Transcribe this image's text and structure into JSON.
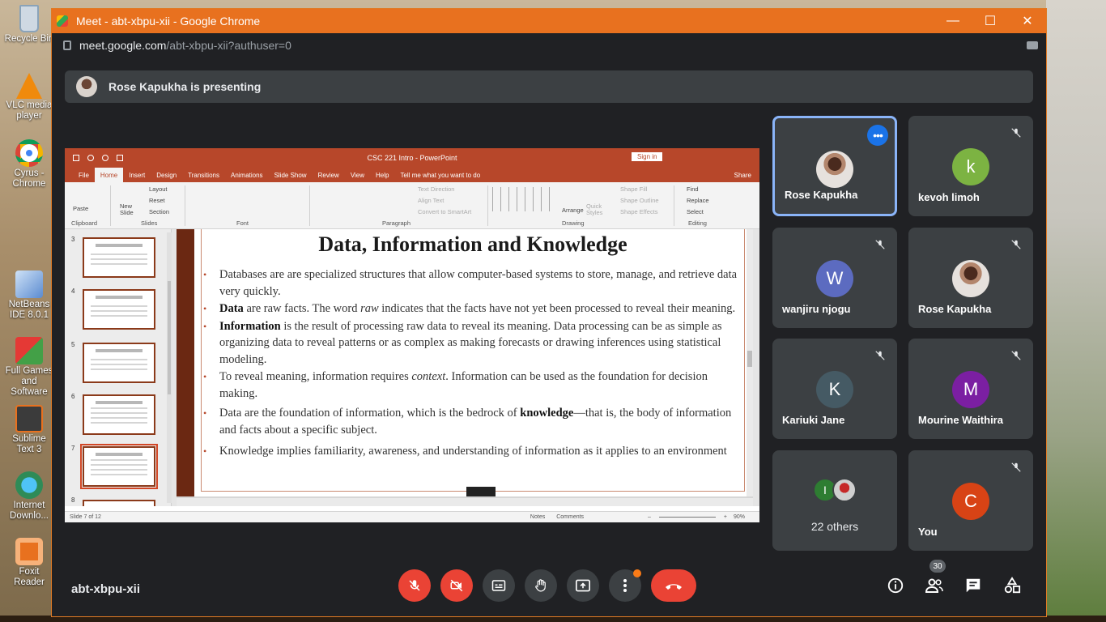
{
  "desktop": {
    "icons": [
      {
        "label": "Recycle Bin",
        "color": "#9fb8cf"
      },
      {
        "label": "VLC media player",
        "color": "#f08a0c"
      },
      {
        "label": "Cyrus - Chrome",
        "color": "#db4437"
      },
      {
        "label": "NetBeans IDE 8.0.1",
        "color": "#5b8bd0"
      },
      {
        "label": "Full Games and Software",
        "color": "#c62828"
      },
      {
        "label": "Sublime Text 3",
        "color": "#e8711f"
      },
      {
        "label": "Internet Downlo...",
        "color": "#2e8b57"
      },
      {
        "label": "Foxit Reader",
        "color": "#e8711f"
      }
    ]
  },
  "window": {
    "title": "Meet - abt-xbpu-xii - Google Chrome",
    "url_host": "meet.google.com",
    "url_path": "/abt-xbpu-xii?authuser=0",
    "accent": "#e8711f"
  },
  "meet": {
    "presenting_banner": "Rose Kapukha is presenting",
    "meeting_code": "abt-xbpu-xii",
    "participant_count": "30",
    "others_label": "22 others",
    "tiles": [
      {
        "name": "Rose Kapukha",
        "initial": "",
        "avatar_color": "",
        "muted": false,
        "active": true
      },
      {
        "name": "kevoh limoh",
        "initial": "k",
        "avatar_color": "#7cb342",
        "muted": true,
        "active": false
      },
      {
        "name": "wanjiru njogu",
        "initial": "W",
        "avatar_color": "#5c6bc0",
        "muted": true,
        "active": false
      },
      {
        "name": "Rose Kapukha",
        "initial": "",
        "avatar_color": "",
        "muted": true,
        "active": false
      },
      {
        "name": "Kariuki Jane",
        "initial": "K",
        "avatar_color": "#455a64",
        "muted": true,
        "active": false
      },
      {
        "name": "Mourine Waithira",
        "initial": "M",
        "avatar_color": "#7b1fa2",
        "muted": true,
        "active": false
      },
      {
        "name": "You",
        "initial": "C",
        "avatar_color": "#d84315",
        "muted": true,
        "active": false
      }
    ],
    "others_initial": "I",
    "others_initial_color": "#2e7d32"
  },
  "powerpoint": {
    "window_title": "CSC 221 Intro  -  PowerPoint",
    "sign_in": "Sign in",
    "tabs": [
      "File",
      "Home",
      "Insert",
      "Design",
      "Transitions",
      "Animations",
      "Slide Show",
      "Review",
      "View",
      "Help",
      "Tell me what you want to do"
    ],
    "share": "Share",
    "ribbon": {
      "paste": "Paste",
      "new_slide": "New Slide",
      "layout": "Layout",
      "reset": "Reset",
      "section": "Section",
      "text_direction": "Text Direction",
      "align_text": "Align Text",
      "convert_smartart": "Convert to SmartArt",
      "arrange": "Arrange",
      "quick_styles": "Quick Styles",
      "shape_fill": "Shape Fill",
      "shape_outline": "Shape Outline",
      "shape_effects": "Shape Effects",
      "find": "Find",
      "replace": "Replace",
      "select": "Select",
      "groups": [
        "Clipboard",
        "Slides",
        "Font",
        "Paragraph",
        "Drawing",
        "Editing"
      ]
    },
    "thumb_numbers": [
      "3",
      "4",
      "5",
      "6",
      "7",
      "8"
    ],
    "slide": {
      "title": "Data, Information and Knowledge",
      "b1": "Databases are are specialized structures that allow computer-based systems to store, manage, and retrieve data very quickly.",
      "b2_bold": "Data",
      "b2_a": " are raw facts. The word ",
      "b2_em": "raw",
      "b2_b": " indicates that the facts have not yet been processed to reveal their meaning.",
      "b3_bold": "Information",
      "b3": " is the result of processing raw data to reveal its meaning. Data processing can be as simple as organizing data to reveal patterns or as complex as making forecasts or drawing inferences using statistical modeling.",
      "b4_a": "To reveal meaning, information requires ",
      "b4_em": "context",
      "b4_b": ". Information can be used as the foundation for decision making.",
      "b5_a": "Data are the foundation of information, which is the bedrock of ",
      "b5_bold": "knowledge",
      "b5_b": "—that is, the body of information and facts about a specific subject.",
      "b6": "Knowledge implies familiarity, awareness, and understanding of information as it applies to an environment"
    },
    "status": {
      "slide_of": "Slide 7 of 12",
      "notes": "Notes",
      "comments": "Comments",
      "zoom": "90%"
    }
  }
}
